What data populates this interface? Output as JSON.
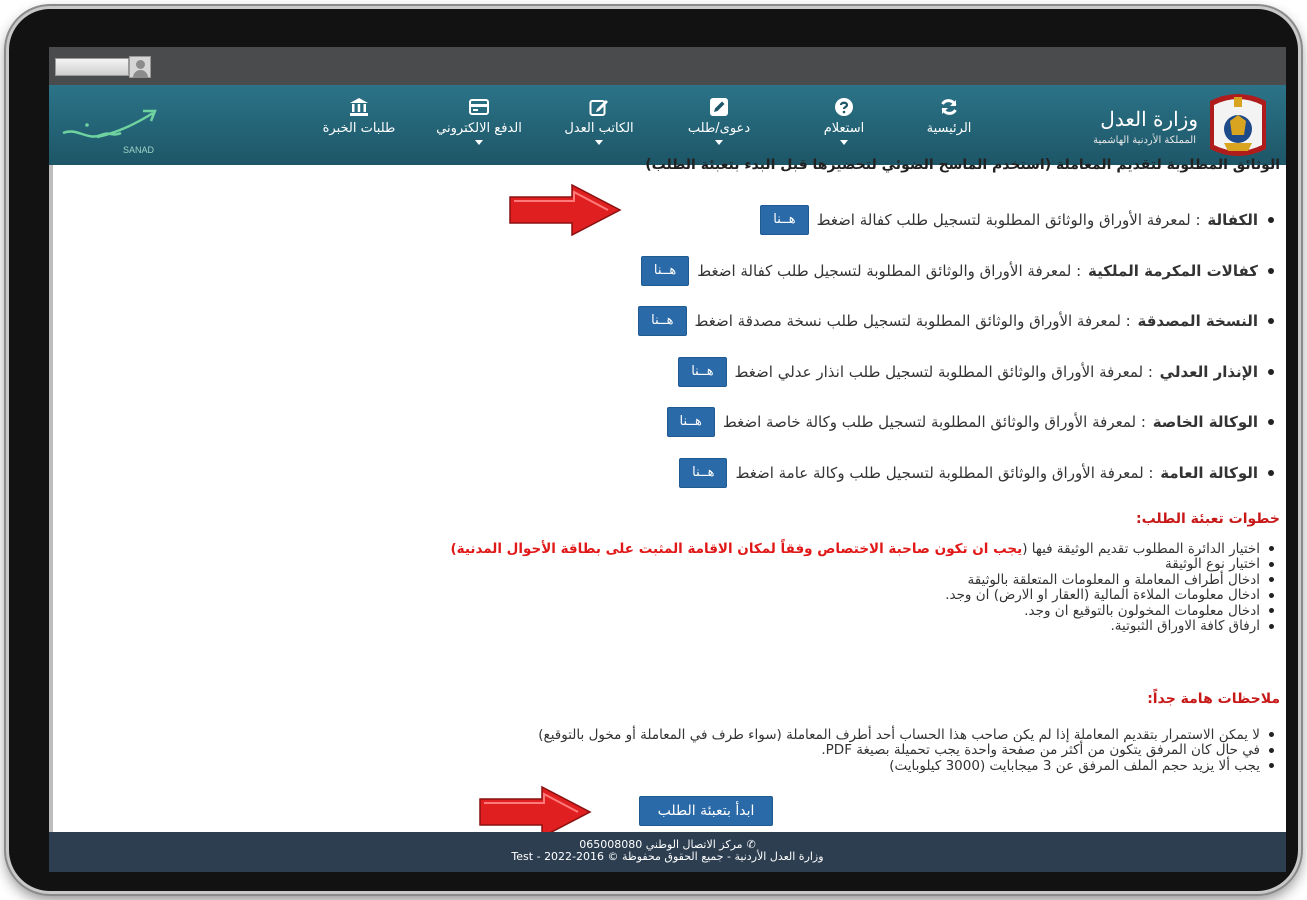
{
  "navbar": {
    "ministry_name": "وزارة العدل",
    "ministry_sub": "المملكة الأردنية الهاشمية",
    "sanad_label": "SANAD",
    "items": [
      {
        "label": "الرئيسية",
        "icon": "refresh-icon",
        "caret": false
      },
      {
        "label": "استعلام",
        "icon": "question-icon",
        "caret": true
      },
      {
        "label": "دعوى/طلب",
        "icon": "edit-icon",
        "caret": true
      },
      {
        "label": "الكاتب العدل",
        "icon": "pencil-square-icon",
        "caret": true
      },
      {
        "label": "الدفع الالكتروني",
        "icon": "credit-card-icon",
        "caret": true
      },
      {
        "label": "طلبات الخبرة",
        "icon": "bank-icon",
        "caret": false
      }
    ]
  },
  "content": {
    "cut_heading": "الوثائق المطلوبة لتقديم المعاملة (استخدم الماسح الضوئي لتحضيرها قبل البدء بتعبئة الطلب)",
    "here_label": "هــنا",
    "documents": [
      {
        "title": "الكفالة",
        "desc": ": لمعرفة الأوراق والوثائق المطلوبة لتسجيل طلب كفالة اضغط"
      },
      {
        "title": "كفالات المكرمة الملكية",
        "desc": ": لمعرفة الأوراق والوثائق المطلوبة لتسجيل طلب كفالة اضغط"
      },
      {
        "title": "النسخة المصدقة",
        "desc": ": لمعرفة الأوراق والوثائق المطلوبة لتسجيل طلب نسخة مصدقة اضغط"
      },
      {
        "title": "الإنذار العدلي",
        "desc": ": لمعرفة الأوراق والوثائق المطلوبة لتسجيل طلب انذار عدلي اضغط"
      },
      {
        "title": "الوكالة الخاصة",
        "desc": ": لمعرفة الأوراق والوثائق المطلوبة لتسجيل طلب وكالة خاصة اضغط"
      },
      {
        "title": "الوكالة العامة",
        "desc": ": لمعرفة الأوراق والوثائق المطلوبة لتسجيل طلب وكالة عامة اضغط"
      }
    ],
    "steps_title": "خطوات تعبئة الطلب:",
    "steps": [
      {
        "text": "اختيار الدائرة المطلوب تقديم الوثيقة فيها (",
        "warn": "يجب ان تكون صاحبة الاختصاص وفقاً لمكان الاقامة المثبت على بطاقة الأحوال المدنية",
        "tail": ")"
      },
      {
        "text": "اختيار نوع الوثيقة",
        "warn": "",
        "tail": ""
      },
      {
        "text": "ادخال أطراف المعاملة و المعلومات المتعلقة بالوثيقة",
        "warn": "",
        "tail": ""
      },
      {
        "text": "ادخال معلومات الملاءة المالية (العقار او الارض) ان وجد.",
        "warn": "",
        "tail": ""
      },
      {
        "text": "ادخال معلومات المخولون بالتوقيع ان وجد.",
        "warn": "",
        "tail": ""
      },
      {
        "text": "ارفاق كافة الاوراق الثبوتية.",
        "warn": "",
        "tail": ""
      }
    ],
    "notes_title": "ملاحظات هامة جداً:",
    "notes": [
      "لا يمكن الاستمرار بتقديم المعاملة إذا لم يكن صاحب هذا الحساب أحد أطرف المعاملة (سواء طرف في المعاملة أو مخول بالتوقيع)",
      "في حال كان المرفق يتكون من أكثر من صفحة واحدة يجب تحميلة بصيغة PDF.",
      "يجب ألا يزيد حجم الملف المرفق عن 3 ميجابايت (3000 كيلوبايت)"
    ],
    "start_button": "ابدأ بتعبئة الطلب"
  },
  "footer": {
    "phone_line": "مركز الاتصال الوطني 065008080",
    "copyright": "وزارة العدل الأردنية - جميع الحقوق محفوظة © 2016-2022 - Test"
  },
  "colors": {
    "navbar": "#1d5667",
    "button": "#2a6aa8",
    "warning": "#e01818",
    "footer": "#2c3e50",
    "arrow": "#e02020"
  }
}
